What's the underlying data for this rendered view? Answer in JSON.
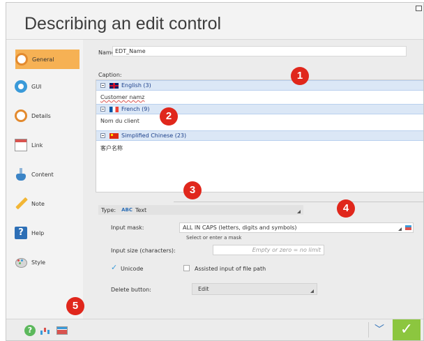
{
  "window": {
    "title": "Describing an edit control"
  },
  "sidebar": {
    "items": [
      {
        "label": "General",
        "icon": "general-icon"
      },
      {
        "label": "GUI",
        "icon": "eye-icon"
      },
      {
        "label": "Details",
        "icon": "details-icon"
      },
      {
        "label": "Link",
        "icon": "link-icon"
      },
      {
        "label": "Content",
        "icon": "flask-icon"
      },
      {
        "label": "Note",
        "icon": "pencil-icon"
      },
      {
        "label": "Help",
        "icon": "help-icon"
      },
      {
        "label": "Style",
        "icon": "palette-icon"
      }
    ],
    "help_glyph": "?"
  },
  "general": {
    "name_label": "Name:",
    "name_value": "EDT_Name",
    "caption_label": "Caption:",
    "languages": [
      {
        "label": "English (3)",
        "text": "Customer namz",
        "flag": "uk-flag"
      },
      {
        "label": "French (9)",
        "text": "Nom du client",
        "flag": "france-flag"
      },
      {
        "label": "Simplified Chinese (23)",
        "text": "客户名称",
        "flag": "china-flag"
      }
    ],
    "type_label": "Type:",
    "type_abc": "ABC",
    "type_value": "Text",
    "input_mask_label": "Input mask:",
    "input_mask_value": "ALL IN CAPS (letters, digits and symbols)",
    "input_mask_hint": "Select or enter a mask",
    "input_size_label": "Input size (characters):",
    "input_size_placeholder": "Empty or zero = no limit",
    "unicode_label": "Unicode",
    "unicode_checked": true,
    "assisted_label": "Assisted input of file path",
    "assisted_checked": false,
    "delete_button_label": "Delete button:",
    "delete_button_value": "Edit"
  },
  "callouts": [
    "1",
    "2",
    "3",
    "4",
    "5"
  ],
  "bottombar": {
    "help_glyph": "?",
    "chevron_glyph": "﹀",
    "ok_glyph": "✓"
  },
  "colors": {
    "accent": "#f6b154",
    "callout": "#e0271c",
    "ok": "#8cc63f",
    "lang_row": "#dbe7f6"
  }
}
